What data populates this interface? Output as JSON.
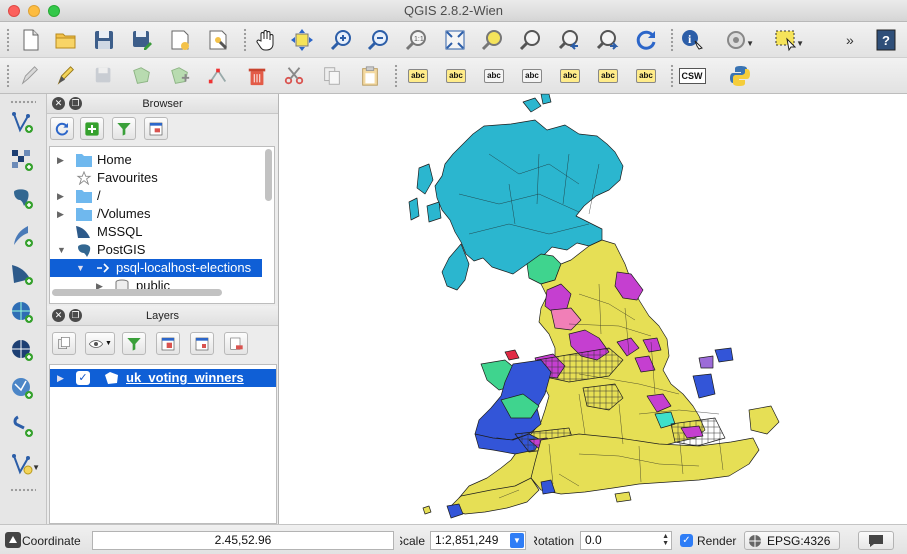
{
  "window": {
    "title": "QGIS 2.8.2-Wien"
  },
  "toolbar_file_icons": [
    "new-project-icon",
    "open-project-icon",
    "save-project-icon",
    "save-as-icon",
    "new-print-composer-icon",
    "composer-manager-icon"
  ],
  "toolbar_nav_icons": [
    "pan-icon",
    "pan-to-selection-icon",
    "zoom-in-icon",
    "zoom-out-icon",
    "zoom-native-icon",
    "zoom-full-icon",
    "zoom-to-selection-icon",
    "zoom-to-layer-icon",
    "zoom-last-icon",
    "zoom-next-icon",
    "refresh-icon",
    "identify-icon",
    "action-icon",
    "select-features-icon",
    "help-icon"
  ],
  "label_tool_text": "abc",
  "csw_label": "CSW",
  "overflow_label": "»",
  "browser": {
    "title": "Browser",
    "items": [
      {
        "label": "Home",
        "icon": "folder-icon",
        "expandable": true
      },
      {
        "label": "Favourites",
        "icon": "star-icon",
        "expandable": false
      },
      {
        "label": "/",
        "icon": "folder-icon",
        "expandable": true
      },
      {
        "label": "/Volumes",
        "icon": "folder-icon",
        "expandable": true
      },
      {
        "label": "MSSQL",
        "icon": "mssql-icon",
        "expandable": false
      },
      {
        "label": "PostGIS",
        "icon": "postgis-icon",
        "expandable": true,
        "expanded": true
      },
      {
        "label": "psql-localhost-elections",
        "icon": "connection-icon",
        "expandable": true,
        "expanded": true,
        "selected": true
      },
      {
        "label": "public",
        "icon": "schema-icon",
        "expandable": true
      }
    ]
  },
  "layers": {
    "title": "Layers",
    "items": [
      {
        "label": "uk_voting_winners",
        "checked": true,
        "selected": true,
        "icon": "polygon-layer-icon"
      }
    ]
  },
  "statusbar": {
    "coordinate_label": "Coordinate",
    "coordinate_value": "2.45,52.96",
    "scale_label": "Scale",
    "scale_value": "1:2,851,249",
    "rotation_label": "Rotation",
    "rotation_value": "0.0",
    "render_label": "Render",
    "render_checked": true,
    "crs_label": "EPSG:4326"
  },
  "map": {
    "layer": "uk_voting_winners",
    "party_colors": {
      "scotland": "#2bb6cf",
      "conservative": "#e6df55",
      "labour": "#c53fd0",
      "welsh": "#3355d8",
      "other_green": "#3fd48e",
      "lib_dem": "#f17fb7",
      "other_teal": "#3ee0cb",
      "independent": "#9c6bd8",
      "red": "#e02b45"
    }
  }
}
